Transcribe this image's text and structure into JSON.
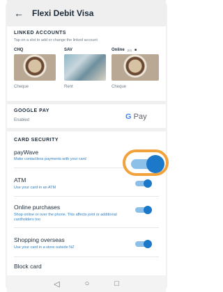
{
  "header": {
    "back_icon": "arrow-left-icon",
    "title": "Flexi Debit Visa"
  },
  "linked_accounts": {
    "heading": "LINKED ACCOUNTS",
    "hint": "Tap on a slot to add or change the linked account",
    "slots": [
      {
        "name": "CHQ",
        "account": "Cheque"
      },
      {
        "name": "SAV",
        "account": "Rent"
      },
      {
        "name": "Online",
        "badge": "2/4",
        "account": "Cheque"
      }
    ]
  },
  "google_pay": {
    "heading": "GOOGLE PAY",
    "status": "Enabled",
    "logo_g": "G",
    "logo_text": "Pay"
  },
  "card_security": {
    "heading": "CARD SECURITY",
    "items": [
      {
        "title": "payWave",
        "desc": "Make contactless payments with your card",
        "enabled": true
      },
      {
        "title": "ATM",
        "desc": "Use your card in an ATM",
        "enabled": true
      },
      {
        "title": "Online purchases",
        "desc": "Shop online or over the phone. This affects joint or additional cardholders too",
        "enabled": true
      },
      {
        "title": "Shopping overseas",
        "desc": "Use your card in a store outside NZ",
        "enabled": true
      },
      {
        "title": "Block card",
        "desc": ""
      }
    ]
  },
  "navbar": {
    "back": "◁",
    "home": "○",
    "recent": "□"
  },
  "colors": {
    "accent": "#1c78c9",
    "highlight": "#f2a23a",
    "link": "#2f80c3"
  }
}
